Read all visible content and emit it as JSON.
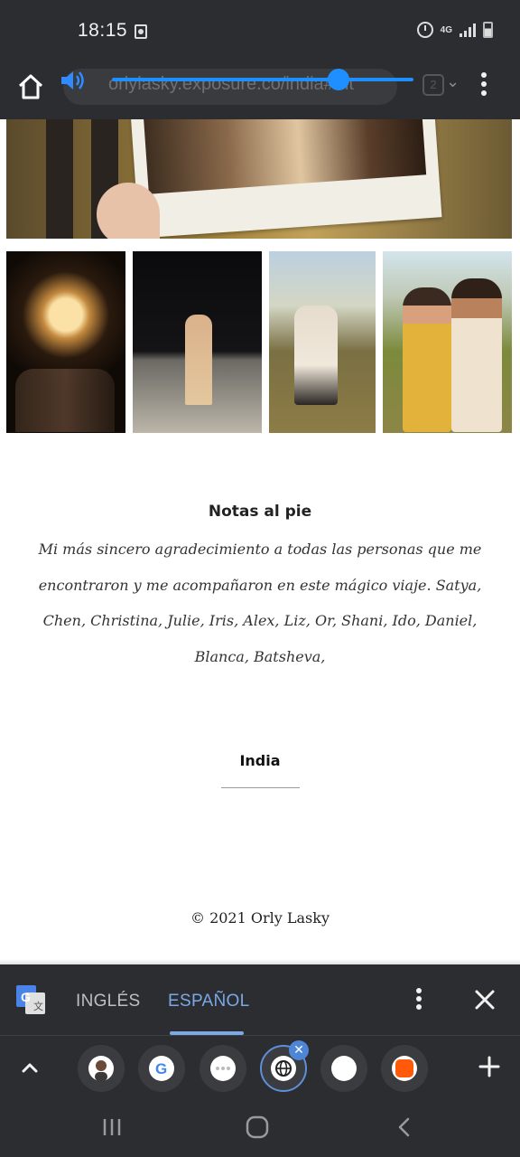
{
  "status_bar": {
    "time": "18:15",
    "network": "4G",
    "icons": [
      "screen-record-icon",
      "alarm-icon",
      "signal-icon",
      "battery-icon"
    ]
  },
  "browser": {
    "url": "orlylasky.exposure.co/india#mt",
    "tab_count": "2",
    "volume_level": 0.75,
    "accent": "#1f8fff"
  },
  "page": {
    "footnote_title": "Notas al pie",
    "footnote_body": "Mi más sincero agradecimiento a todas las personas que me encontraron y me acompañaron en este mágico viaje. Satya, Chen, Christina, Julie, Iris, Alex, Liz, Or, Shani, Ido, Daniel, Blanca, Batsheva,",
    "section_title": "India",
    "copyright": "© 2021 Orly Lasky"
  },
  "translate_bar": {
    "source_lang": "INGLÉS",
    "target_lang": "ESPAÑOL",
    "active_color": "#7aa8e8"
  },
  "tab_strip": {
    "tabs": [
      "avatar-tab",
      "google-tab",
      "blank-tab",
      "globe-tab",
      "white-tab",
      "orange-tab"
    ],
    "close_badge": "✕"
  }
}
